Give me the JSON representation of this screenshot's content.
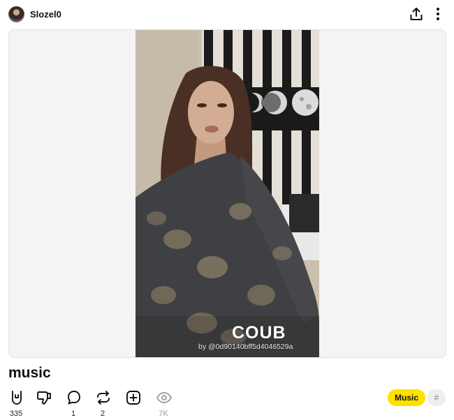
{
  "header": {
    "username": "Slozel0",
    "avatar_icon": "user-avatar",
    "share_icon": "share-upload-icon",
    "more_icon": "more-vertical-icon"
  },
  "player": {
    "watermark_logo": "COUB",
    "watermark_by": "by @0d90140bff5d4046529a"
  },
  "post": {
    "title": "music"
  },
  "actions": {
    "like_count": "335",
    "dislike_count": "",
    "comments_count": "1",
    "recoubs_count": "2",
    "bookmark_count": "",
    "views_count": "7K"
  },
  "tags": {
    "primary": "Music",
    "hash": "#"
  },
  "colors": {
    "tag_accent": "#ffe100",
    "text": "#111111",
    "muted": "#999999"
  }
}
